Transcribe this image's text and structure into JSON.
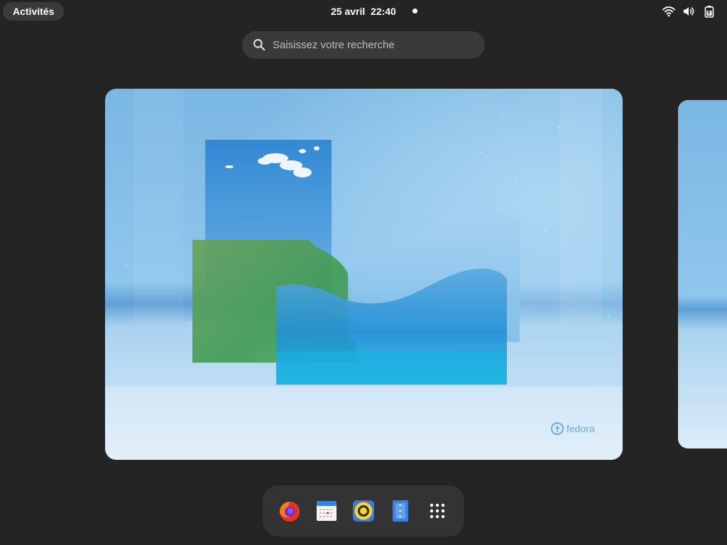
{
  "topbar": {
    "activities_label": "Activités",
    "clock": "25 avril  22:40",
    "status_icons": [
      "wifi-icon",
      "volume-icon",
      "battery-icon"
    ]
  },
  "search": {
    "placeholder": "Saisissez votre recherche",
    "icon": "search-icon"
  },
  "workspaces": [
    {
      "name": "current",
      "wallpaper": "fedora-glass-shapes",
      "brand": "fedora"
    },
    {
      "name": "next",
      "wallpaper": "fedora-glass-shapes"
    }
  ],
  "dash": {
    "apps": [
      "firefox-icon",
      "calendar-icon",
      "rhythmbox-icon",
      "files-icon",
      "app-grid-icon"
    ]
  },
  "colors": {
    "panel": "#242424",
    "pill": "#3a3a3a",
    "dash": "#333333",
    "sky": "#7cbde6"
  }
}
